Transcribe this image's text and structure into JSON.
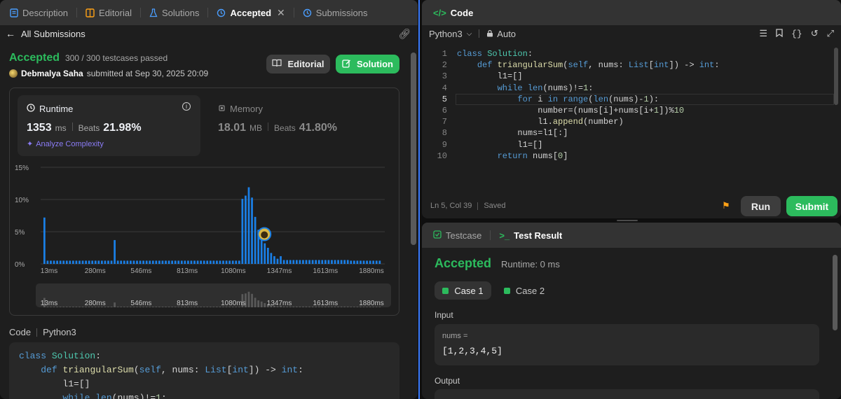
{
  "left_tabs": [
    {
      "label": "Description",
      "icon": "description-icon"
    },
    {
      "label": "Editorial",
      "icon": "editorial-icon"
    },
    {
      "label": "Solutions",
      "icon": "flask-icon"
    },
    {
      "label": "Accepted",
      "icon": "history-icon"
    },
    {
      "label": "Submissions",
      "icon": "history-icon"
    }
  ],
  "nav": {
    "back_label": "All Submissions"
  },
  "result": {
    "status": "Accepted",
    "testcases": "300 / 300 testcases passed",
    "user": "Debmalya Saha",
    "submitted": "submitted at Sep 30, 2025 20:09",
    "editorial_btn": "Editorial",
    "solution_btn": "Solution"
  },
  "runtime": {
    "label": "Runtime",
    "value": "1353",
    "unit": "ms",
    "beats_label": "Beats",
    "beats": "21.98%",
    "analyze": "Analyze Complexity"
  },
  "memory": {
    "label": "Memory",
    "value": "18.01",
    "unit": "MB",
    "beats_label": "Beats",
    "beats": "41.80%"
  },
  "colors": {
    "accent": "#2cbb5d",
    "bar": "#1a7fe6",
    "link": "#8b7cf6"
  },
  "chart_data": {
    "type": "bar",
    "ytick_labels": [
      "15%",
      "10%",
      "5%",
      "0%"
    ],
    "ylim": [
      0,
      15
    ],
    "xtick_labels": [
      "13ms",
      "280ms",
      "546ms",
      "813ms",
      "1080ms",
      "1347ms",
      "1613ms",
      "1880ms"
    ],
    "values": [
      7.2,
      0.5,
      0.5,
      0.5,
      0.5,
      0.5,
      0.5,
      0.5,
      0.5,
      0.5,
      0.5,
      0.5,
      0.5,
      0.5,
      0.5,
      0.5,
      0.5,
      0.5,
      0.5,
      0.5,
      0.5,
      0.5,
      3.7,
      0.5,
      0.5,
      0.5,
      0.5,
      0.5,
      0.5,
      0.5,
      0.5,
      0.5,
      0.5,
      0.5,
      0.5,
      0.5,
      0.5,
      0.5,
      0.5,
      0.5,
      0.5,
      0.5,
      0.5,
      0.5,
      0.5,
      0.5,
      0.5,
      0.5,
      0.5,
      0.5,
      0.5,
      0.5,
      0.5,
      0.5,
      0.5,
      0.5,
      0.5,
      0.5,
      0.5,
      0.5,
      0.5,
      0.5,
      10.1,
      10.6,
      11.9,
      10.3,
      7.3,
      5.3,
      4.4,
      3.2,
      2.5,
      1.7,
      1.2,
      0.8,
      1.2,
      0.6,
      0.6,
      0.6,
      0.6,
      0.6,
      0.6,
      0.6,
      0.6,
      0.6,
      0.6,
      0.6,
      0.6,
      0.6,
      0.6,
      0.6,
      0.6,
      0.6,
      0.6,
      0.6,
      0.6,
      0.6,
      0.5,
      0.5,
      0.5,
      0.5,
      0.5,
      0.5,
      0.5,
      0.5,
      0.5,
      0.5
    ],
    "highlight_index": 68,
    "grid": true
  },
  "code_section": {
    "label": "Code",
    "lang": "Python3"
  },
  "code_lines": [
    "class Solution:",
    "    def triangularSum(self, nums: List[int]) -> int:",
    "        l1=[]",
    "        while len(nums)!=1:",
    "            for i in range(len(nums)-1):",
    "                number=(nums[i]+nums[i+1])%10",
    "                l1.append(number)",
    "            nums=l1[:]",
    "            l1=[]",
    "        return nums[0]"
  ],
  "line_numbers": [
    "1",
    "2",
    "3",
    "4",
    "5",
    "6",
    "7",
    "8",
    "9",
    "10"
  ],
  "editor": {
    "title": "Code",
    "lang": "Python3",
    "mode": "Auto",
    "status_pos": "Ln 5, Col 39",
    "status_saved": "Saved",
    "run_btn": "Run",
    "submit_btn": "Submit"
  },
  "test": {
    "tab_testcase": "Testcase",
    "tab_result": "Test Result",
    "status": "Accepted",
    "runtime": "Runtime: 0 ms",
    "case1": "Case 1",
    "case2": "Case 2",
    "input_label": "Input",
    "var_label": "nums =",
    "var_value": "[1,2,3,4,5]",
    "output_label": "Output"
  }
}
